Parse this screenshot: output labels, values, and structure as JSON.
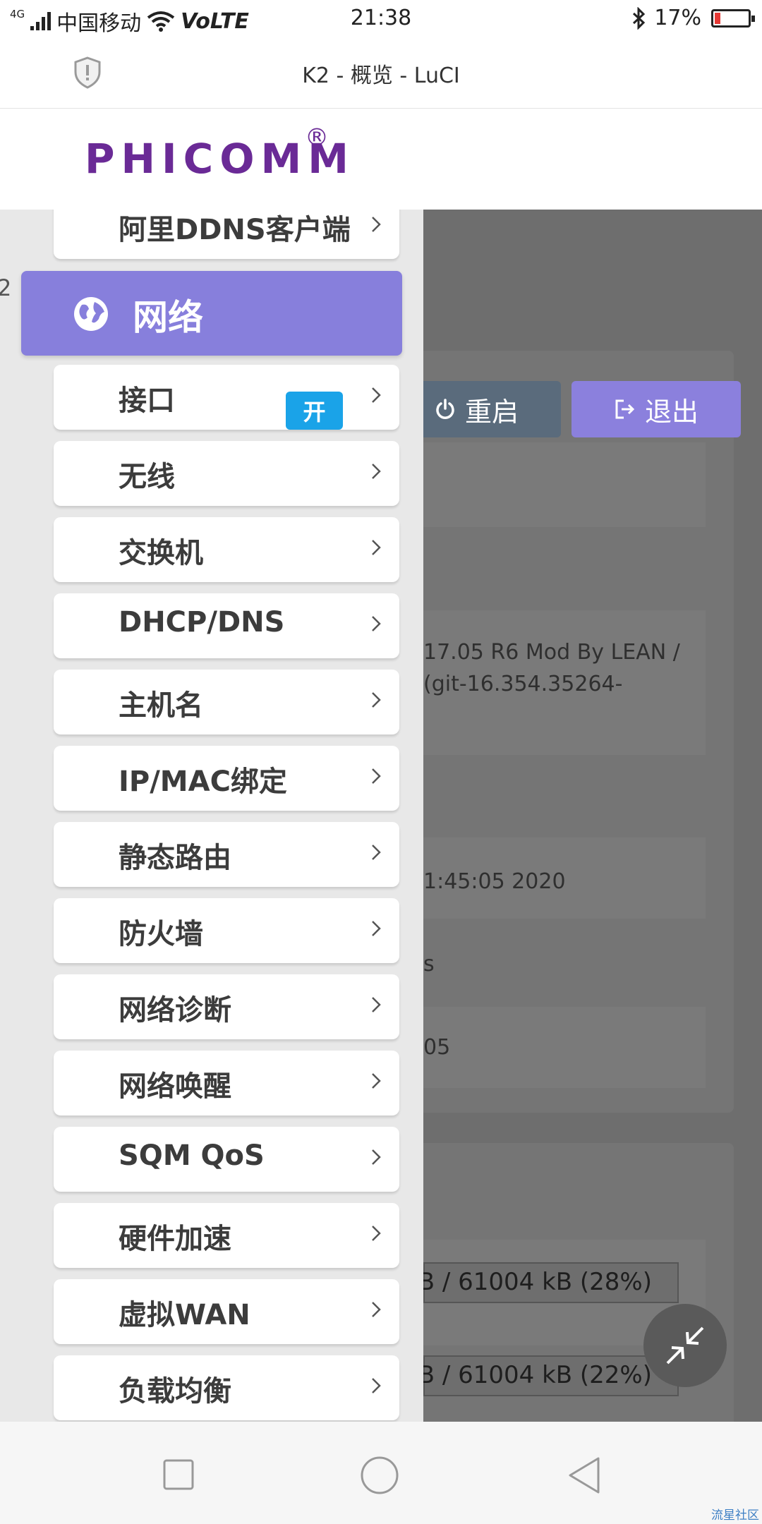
{
  "status_bar": {
    "network_type": "4G",
    "carrier": "中国移动",
    "volte": "VoLTE",
    "time": "21:38",
    "battery_percent": "17%",
    "battery_level": 0.17
  },
  "browser": {
    "page_title": "K2 - 概览 - LuCI"
  },
  "header": {
    "brand": "PHICOMM",
    "registered_mark": "®"
  },
  "actions": {
    "reboot_label": "重启",
    "logout_label": "退出"
  },
  "sidebar": {
    "partial_item": "阿里DDNS客户端",
    "edge_char": "2",
    "section_label": "网络",
    "items": [
      {
        "label": "接口"
      },
      {
        "label": "无线"
      },
      {
        "label": "交换机"
      },
      {
        "label": "DHCP/DNS"
      },
      {
        "label": "主机名"
      },
      {
        "label": "IP/MAC绑定"
      },
      {
        "label": "静态路由"
      },
      {
        "label": "防火墙"
      },
      {
        "label": "网络诊断"
      },
      {
        "label": "网络唤醒"
      },
      {
        "label": "SQM QoS"
      },
      {
        "label": "硬件加速"
      },
      {
        "label": "虚拟WAN"
      },
      {
        "label": "负载均衡"
      }
    ]
  },
  "toggle_badge": "开",
  "background_page": {
    "firmware_line1": "17.05 R6 Mod By LEAN /",
    "firmware_line2": "(git-16.354.35264-",
    "local_time": "1:45:05 2020",
    "uptime_fragment": "s",
    "load_fragment": "05",
    "memory_total": "B / 61004 kB (28%)",
    "memory_free": "B / 61004 kB (22%)"
  },
  "footer": {
    "watermark": "流星社区"
  }
}
